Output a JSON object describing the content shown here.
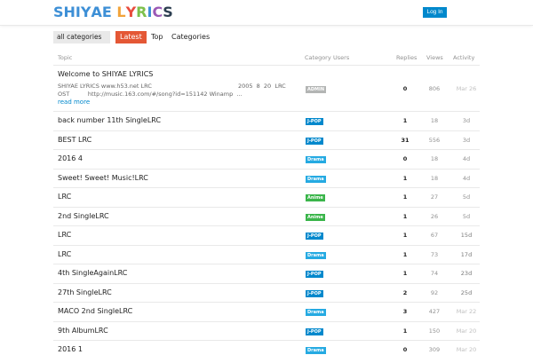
{
  "header": {
    "logo_letters": [
      {
        "ch": "S",
        "color": "#3d8fd6"
      },
      {
        "ch": "H",
        "color": "#3d8fd6"
      },
      {
        "ch": "I",
        "color": "#3d8fd6"
      },
      {
        "ch": "Y",
        "color": "#3d8fd6"
      },
      {
        "ch": "A",
        "color": "#3d8fd6"
      },
      {
        "ch": "E",
        "color": "#3d8fd6"
      },
      {
        "ch": " ",
        "color": "#3d8fd6"
      },
      {
        "ch": "L",
        "color": "#f2a33a"
      },
      {
        "ch": "Y",
        "color": "#e84c3d"
      },
      {
        "ch": "R",
        "color": "#7dc04b"
      },
      {
        "ch": "I",
        "color": "#3d8fd6"
      },
      {
        "ch": "C",
        "color": "#9b59b6"
      },
      {
        "ch": "S",
        "color": "#2c3e50"
      }
    ],
    "login_label": "Log In"
  },
  "nav": {
    "category_select": "all categories",
    "tabs": [
      {
        "label": "Latest",
        "active": true
      },
      {
        "label": "Top",
        "active": false
      },
      {
        "label": "Categories",
        "active": false
      }
    ]
  },
  "columns": {
    "topic": "Topic",
    "category": "Category",
    "users": "Users",
    "replies": "Replies",
    "views": "Views",
    "activity": "Activity"
  },
  "pinned": {
    "title": "Welcome to SHIYAE LYRICS",
    "excerpt_line1": "SHIYAE LYRICS www.h53.net LRC                                               2005  8  20  LRC",
    "excerpt_line2": "OST          http://music.163.com/#/song?id=151142 Winamp  ...",
    "read_more": "read more",
    "category": "ADMIN",
    "replies": "0",
    "views": "806",
    "activity": "Mar 26"
  },
  "topics": [
    {
      "title": "back number 11th SingleLRC",
      "category": "J-POP",
      "replies": "1",
      "views": "18",
      "activity": "3d"
    },
    {
      "title": " BEST LRC",
      "category": "J-POP",
      "replies": "31",
      "views": "556",
      "activity": "3d"
    },
    {
      "title": "2016   4",
      "category": "Drama",
      "replies": "0",
      "views": "18",
      "activity": "4d"
    },
    {
      "title": "Sweet! Sweet! Music!LRC",
      "category": "Drama",
      "replies": "1",
      "views": "18",
      "activity": "4d"
    },
    {
      "title": "LRC",
      "category": "Anime",
      "replies": "1",
      "views": "27",
      "activity": "5d"
    },
    {
      "title": " 2nd SingleLRC",
      "category": "Anime",
      "replies": "1",
      "views": "26",
      "activity": "5d"
    },
    {
      "title": "LRC",
      "category": "J-POP",
      "replies": "1",
      "views": "67",
      "activity": "15d"
    },
    {
      "title": "LRC",
      "category": "Drama",
      "replies": "1",
      "views": "73",
      "activity": "17d"
    },
    {
      "title": " 4th SingleAgainLRC",
      "category": "J-POP",
      "replies": "1",
      "views": "74",
      "activity": "23d"
    },
    {
      "title": " 27th SingleLRC",
      "category": "J-POP",
      "replies": "2",
      "views": "92",
      "activity": "25d"
    },
    {
      "title": "MACO 2nd SingleLRC",
      "category": "Drama",
      "replies": "3",
      "views": "427",
      "activity": "Mar 22"
    },
    {
      "title": " 9th AlbumLRC",
      "category": "J-POP",
      "replies": "1",
      "views": "150",
      "activity": "Mar 20"
    },
    {
      "title": "2016   1",
      "category": "Drama",
      "replies": "0",
      "views": "309",
      "activity": "Mar 20"
    }
  ],
  "category_colors": {
    "ADMIN": "#b3b5b4",
    "J-POP": "#0088cc",
    "Drama": "#25aae2",
    "Anime": "#3ab54a"
  }
}
